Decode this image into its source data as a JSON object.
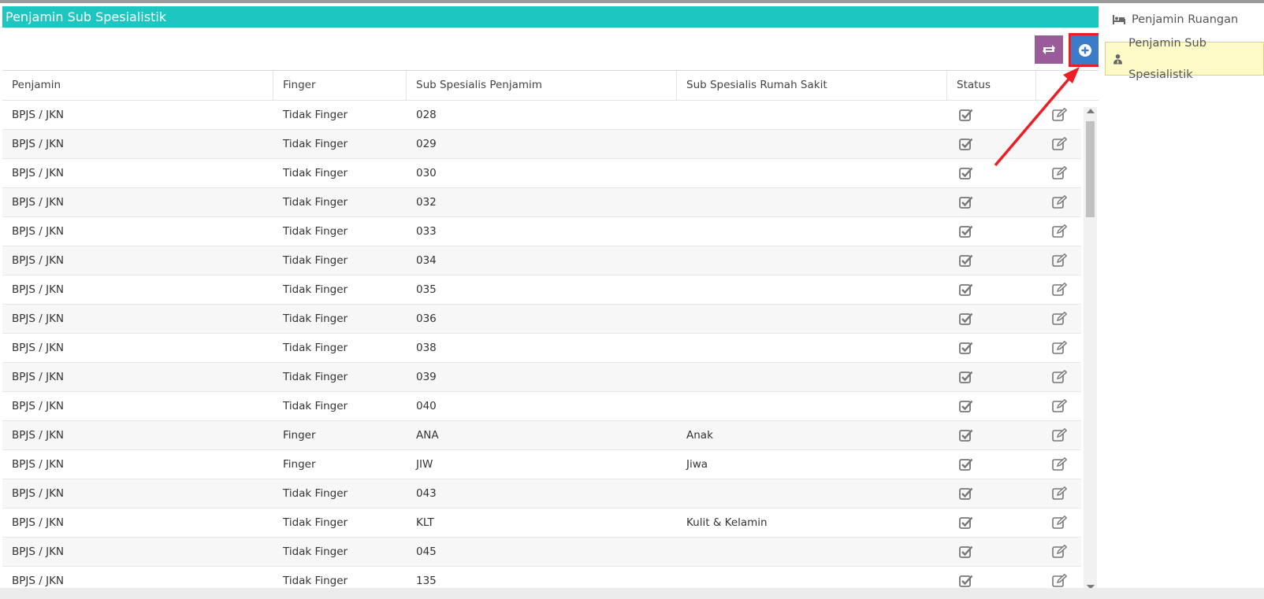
{
  "panel": {
    "title": "Penjamin Sub Spesialistik"
  },
  "toolbar": {
    "refresh_icon": "refresh-icon",
    "add_icon": "plus-circle-icon"
  },
  "table": {
    "columns": [
      "Penjamin",
      "Finger",
      "Sub Spesialis Penjamim",
      "Sub Spesialis Rumah Sakit",
      "Status",
      ""
    ],
    "rows": [
      [
        "BPJS / JKN",
        "Tidak Finger",
        "028",
        ""
      ],
      [
        "BPJS / JKN",
        "Tidak Finger",
        "029",
        ""
      ],
      [
        "BPJS / JKN",
        "Tidak Finger",
        "030",
        ""
      ],
      [
        "BPJS / JKN",
        "Tidak Finger",
        "032",
        ""
      ],
      [
        "BPJS / JKN",
        "Tidak Finger",
        "033",
        ""
      ],
      [
        "BPJS / JKN",
        "Tidak Finger",
        "034",
        ""
      ],
      [
        "BPJS / JKN",
        "Tidak Finger",
        "035",
        ""
      ],
      [
        "BPJS / JKN",
        "Tidak Finger",
        "036",
        ""
      ],
      [
        "BPJS / JKN",
        "Tidak Finger",
        "038",
        ""
      ],
      [
        "BPJS / JKN",
        "Tidak Finger",
        "039",
        ""
      ],
      [
        "BPJS / JKN",
        "Tidak Finger",
        "040",
        ""
      ],
      [
        "BPJS / JKN",
        "Finger",
        "ANA",
        "Anak"
      ],
      [
        "BPJS / JKN",
        "Finger",
        "JIW",
        "Jiwa"
      ],
      [
        "BPJS / JKN",
        "Tidak Finger",
        "043",
        ""
      ],
      [
        "BPJS / JKN",
        "Tidak Finger",
        "KLT",
        "Kulit & Kelamin"
      ],
      [
        "BPJS / JKN",
        "Tidak Finger",
        "045",
        ""
      ],
      [
        "BPJS / JKN",
        "Tidak Finger",
        "135",
        ""
      ]
    ]
  },
  "sidebar": {
    "items": [
      {
        "label": "Penjamin Ruangan",
        "icon": "bed-icon",
        "active": false
      },
      {
        "label": "Penjamin Sub Spesialistik",
        "icon": "user-doctor-icon",
        "active": true
      }
    ]
  },
  "colors": {
    "header": "#1dc6c1",
    "refresh_button": "#9a5b9a",
    "add_button": "#3a7cc8",
    "highlight": "#ee1c24",
    "active_item": "#fffbc9"
  }
}
